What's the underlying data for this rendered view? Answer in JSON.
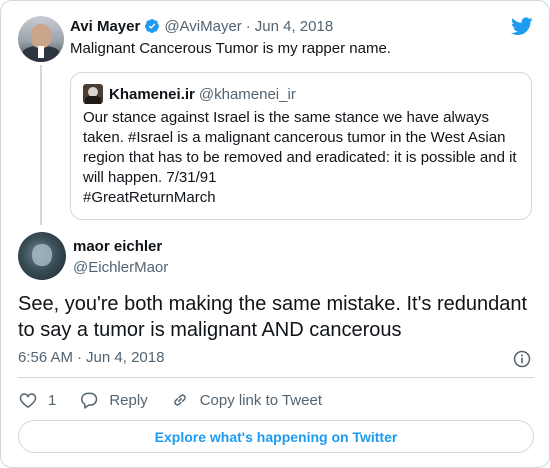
{
  "colors": {
    "accent": "#1d9bf0",
    "text": "#0f1419",
    "secondary": "#536471",
    "border": "#cfd9de"
  },
  "parent_tweet": {
    "name": "Avi Mayer",
    "handle": "@AviMayer",
    "separator": "·",
    "date": "Jun 4, 2018",
    "text": "Malignant Cancerous Tumor is my rapper name.",
    "verified_icon": "verified-badge-icon",
    "quoted": {
      "name": "Khamenei.ir",
      "handle": "@khamenei_ir",
      "lines": [
        "Our stance against Israel is the same stance we have always",
        "taken. #Israel is a malignant cancerous tumor in the West Asian",
        "region that has to be removed and eradicated: it is possible and it",
        "will happen. 7/31/91",
        "#GreatReturnMarch"
      ]
    }
  },
  "reply_tweet": {
    "name": "maor eichler",
    "handle": "@EichlerMaor",
    "lines": [
      "See, you're both making the same mistake. It's redundant",
      "to say a tumor is malignant AND cancerous"
    ],
    "time": "6:56 AM",
    "separator": "·",
    "date": "Jun 4, 2018"
  },
  "actions": {
    "like_count": "1",
    "reply_label": "Reply",
    "copy_link_label": "Copy link to Tweet"
  },
  "explore_label": "Explore what's happening on Twitter"
}
